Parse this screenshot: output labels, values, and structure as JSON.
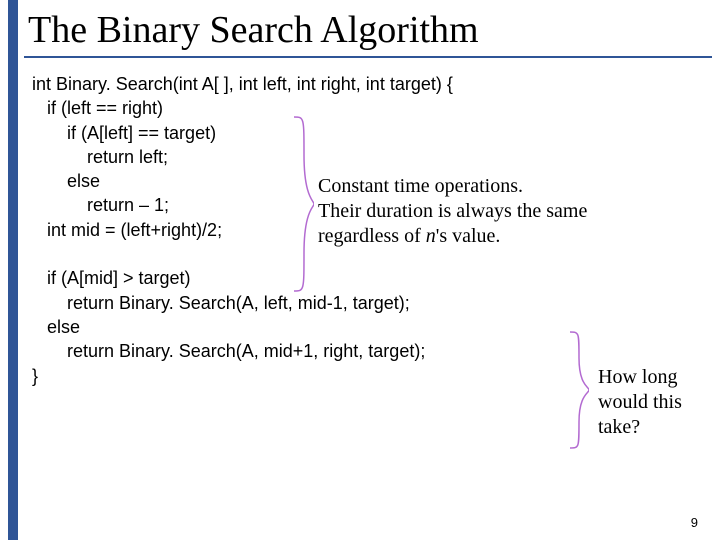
{
  "title": "The Binary Search Algorithm",
  "code": {
    "l1": "int Binary. Search(int A[ ], int left, int right, int target) {",
    "l2": "   if (left == right)",
    "l3": "       if (A[left] == target)",
    "l4": "           return left;",
    "l5": "       else",
    "l6": "           return – 1;",
    "l7": "   int mid = (left+right)/2;",
    "l8": "",
    "l9": "   if (A[mid] > target)",
    "l10": "       return Binary. Search(A, left, mid-1, target);",
    "l11": "   else",
    "l12": "       return Binary. Search(A, mid+1, right, target);",
    "l13": "}"
  },
  "annotations": {
    "a1_pre": "Constant time operations.\nTheir duration is always the same\nregardless of ",
    "a1_italic": "n",
    "a1_post": "'s value.",
    "a2": "How long would this take?"
  },
  "page_number": "9",
  "colors": {
    "accent": "#2f5597"
  }
}
